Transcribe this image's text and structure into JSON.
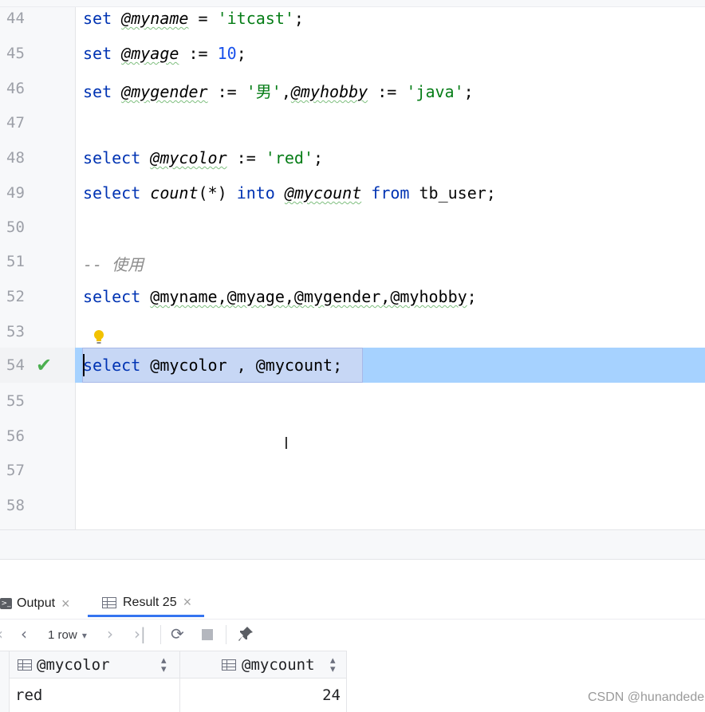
{
  "editor": {
    "lines": [
      {
        "n": "44"
      },
      {
        "n": "45"
      },
      {
        "n": "46"
      },
      {
        "n": "47"
      },
      {
        "n": "48"
      },
      {
        "n": "49"
      },
      {
        "n": "50"
      },
      {
        "n": "51"
      },
      {
        "n": "52"
      },
      {
        "n": "53"
      },
      {
        "n": "54"
      },
      {
        "n": "55"
      },
      {
        "n": "56"
      },
      {
        "n": "57"
      },
      {
        "n": "58"
      }
    ],
    "tokens": {
      "set": "set",
      "select": "select",
      "into": "into",
      "from": "from",
      "myname": "@myname",
      "myage": "@myage",
      "mygender": "@mygender",
      "myhobby": "@myhobby",
      "mycolor": "@mycolor",
      "mycount": "@mycount",
      "assign": " := ",
      "eq": " = ",
      "itcast": "'itcast'",
      "ten": "10",
      "nan": "'男'",
      "java": "'java'",
      "red": "'red'",
      "count": "count",
      "star": "(*)",
      "tb_user": "tb_user",
      "semi": ";",
      "comma": ",",
      "comment": "-- 使用",
      "l52_rest": "@myname,@myage,@mygender,@myhobby",
      "l54_a": "@mycolor",
      "l54_sep": " , ",
      "l54_b": "@mycount"
    },
    "current_line": "54",
    "check_mark": "✔"
  },
  "panel": {
    "tabs": [
      {
        "label": "Output",
        "icon": "console-icon"
      },
      {
        "label": "Result 25",
        "icon": "table-icon"
      }
    ],
    "close_glyph": "×",
    "toolbar": {
      "first": "❮",
      "prev": "〈",
      "rows_label": "1 row",
      "rows_chevron": "⌄",
      "next": "〉",
      "last": "〉|",
      "refresh": "⟳",
      "pin": "📌"
    },
    "grid": {
      "columns": [
        "@mycolor",
        "@mycount"
      ],
      "rows": [
        [
          "red",
          "24"
        ]
      ]
    }
  },
  "watermark": "CSDN @hunandede",
  "colors": {
    "keyword": "#0033b3",
    "string": "#067d17",
    "number": "#1750eb",
    "current_line": "#a6d2ff",
    "check": "#4caf50",
    "tab_underline": "#3574f0"
  }
}
